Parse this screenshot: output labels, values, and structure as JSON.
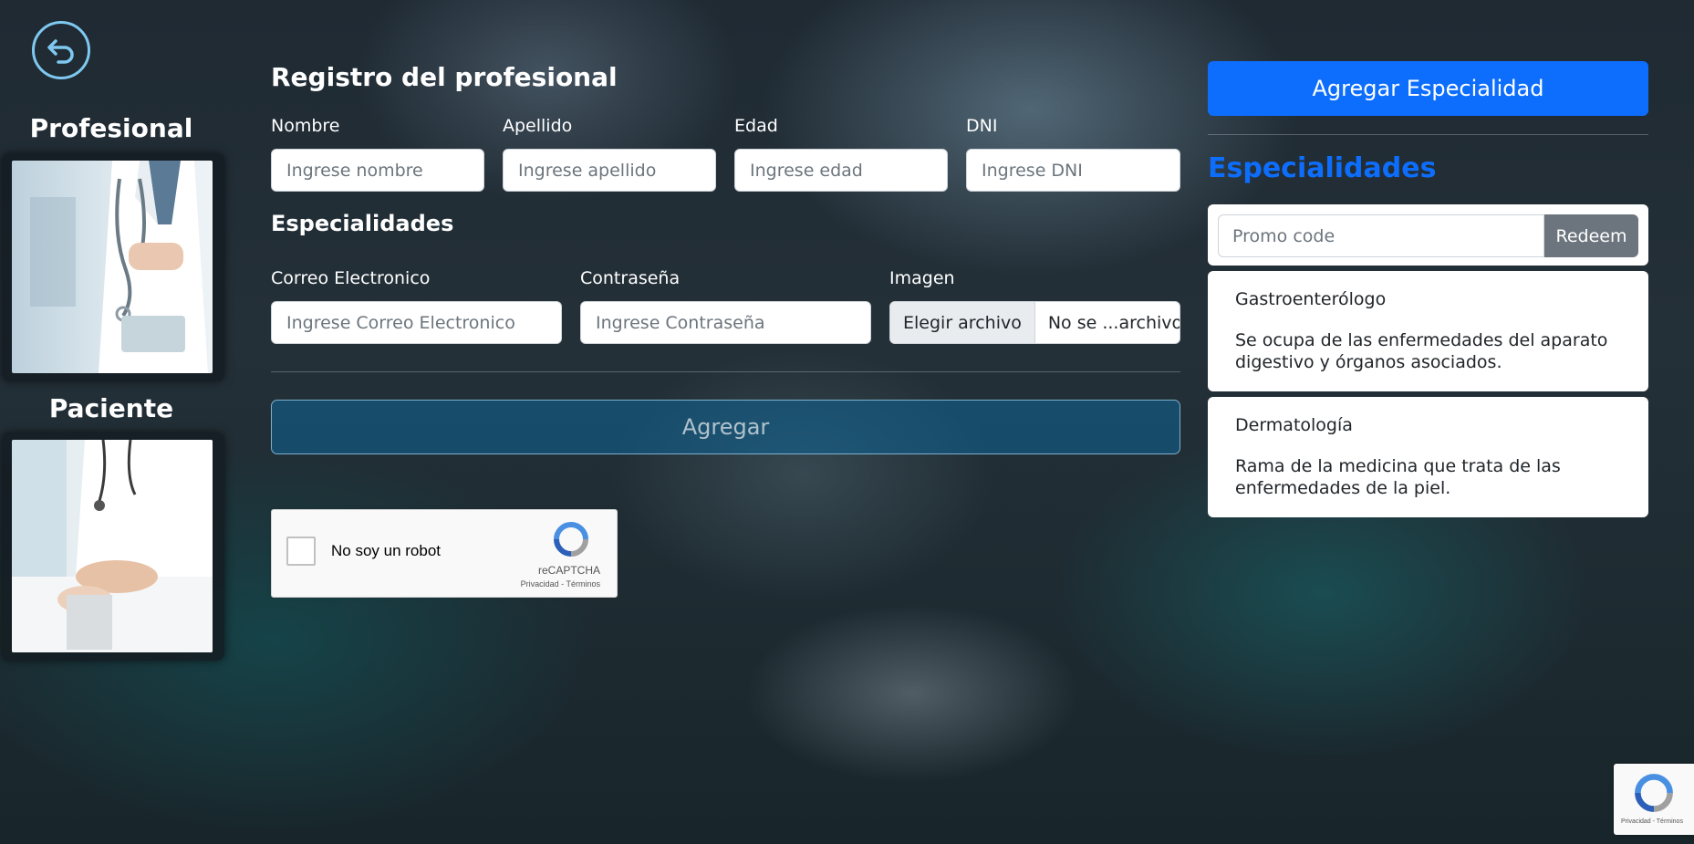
{
  "left_panel": {
    "back_icon": "back-arrow-icon",
    "profesional_title": "Profesional",
    "paciente_title": "Paciente"
  },
  "form": {
    "title": "Registro del profesional",
    "fields": {
      "nombre": {
        "label": "Nombre",
        "placeholder": "Ingrese nombre",
        "value": ""
      },
      "apellido": {
        "label": "Apellido",
        "placeholder": "Ingrese apellido",
        "value": ""
      },
      "edad": {
        "label": "Edad",
        "placeholder": "Ingrese edad",
        "value": ""
      },
      "dni": {
        "label": "DNI",
        "placeholder": "Ingrese DNI",
        "value": ""
      },
      "correo": {
        "label": "Correo Electronico",
        "placeholder": "Ingrese Correo Electronico",
        "value": ""
      },
      "contrasena": {
        "label": "Contraseña",
        "placeholder": "Ingrese Contraseña",
        "value": ""
      }
    },
    "especialidades_subtitle": "Especialidades",
    "imagen": {
      "label": "Imagen",
      "button": "Elegir archivo",
      "file_name": "No se ...archivo"
    },
    "submit_label": "Agregar"
  },
  "captcha": {
    "text": "No soy un robot",
    "brand": "reCAPTCHA",
    "links": "Privacidad - Términos"
  },
  "right_panel": {
    "add_button": "Agregar Especialidad",
    "title": "Especialidades",
    "promo": {
      "placeholder": "Promo code",
      "button": "Redeem"
    },
    "items": [
      {
        "name": "Gastroenterólogo",
        "description": "Se ocupa de las enfermedades del aparato digestivo y órganos asociados."
      },
      {
        "name": "Dermatología",
        "description": "Rama de la medicina que trata de las enfermedades de la piel."
      }
    ]
  },
  "colors": {
    "primary": "#0d6efd",
    "secondary": "#6c757d",
    "back_ring": "#7fc8f0"
  }
}
